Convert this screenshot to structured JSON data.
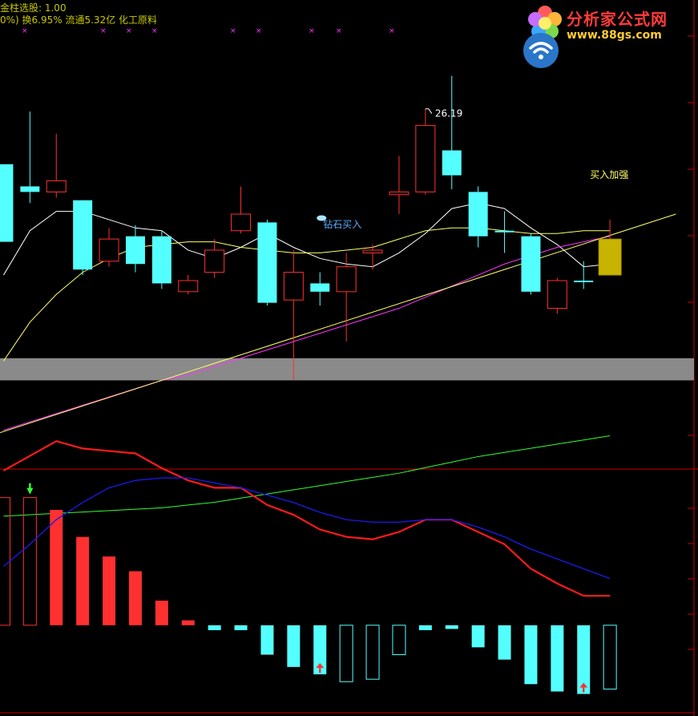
{
  "header": {
    "line1": "金柱选股: 1.00",
    "line2": "0%) 换6.95% 流通5.32亿 化工原料"
  },
  "watermark": {
    "site_name": "分析家公式网",
    "url": "www.88gs.com"
  },
  "colors": {
    "bull": "#ff3030",
    "bear": "#54ffff",
    "ma5": "#ffffff",
    "ma10": "#ffff66",
    "ma20": "#ff33ff",
    "ma60": "#33ff33",
    "trendline": "#ffff66",
    "band": "#8a8a8a",
    "gold": "#c8b400",
    "macd_fast": "#ff1a1a",
    "macd_slow": "#1a1aee",
    "axis": "#cc0000"
  },
  "chart_data": [
    {
      "type": "candlestick",
      "title": "",
      "annotations": [
        {
          "text": "26.19",
          "candle": 16,
          "kind": "high-label"
        },
        {
          "text": "钻石买入",
          "candle": 12,
          "kind": "signal"
        },
        {
          "text": "买入加强",
          "candle": 22,
          "kind": "signal"
        }
      ],
      "price_range": [
        12,
        28
      ],
      "candles": [
        {
          "o": 23.0,
          "c": 20.2,
          "h": 23.0,
          "l": 20.2
        },
        {
          "o": 22.2,
          "c": 22.0,
          "h": 24.9,
          "l": 21.6
        },
        {
          "o": 22.0,
          "c": 22.4,
          "h": 24.1,
          "l": 21.8
        },
        {
          "o": 21.7,
          "c": 19.2,
          "h": 21.7,
          "l": 19.0
        },
        {
          "o": 19.5,
          "c": 20.3,
          "h": 20.7,
          "l": 19.3
        },
        {
          "o": 20.4,
          "c": 19.4,
          "h": 20.8,
          "l": 19.1
        },
        {
          "o": 20.4,
          "c": 18.7,
          "h": 20.6,
          "l": 18.5
        },
        {
          "o": 18.4,
          "c": 18.8,
          "h": 19.0,
          "l": 18.3
        },
        {
          "o": 19.1,
          "c": 19.9,
          "h": 20.3,
          "l": 18.9
        },
        {
          "o": 20.6,
          "c": 21.2,
          "h": 22.2,
          "l": 20.5
        },
        {
          "o": 20.9,
          "c": 18.0,
          "h": 21.0,
          "l": 17.9
        },
        {
          "o": 18.1,
          "c": 19.1,
          "h": 19.9,
          "l": 15.2
        },
        {
          "o": 18.7,
          "c": 18.4,
          "h": 19.1,
          "l": 17.9
        },
        {
          "o": 18.4,
          "c": 19.3,
          "h": 19.8,
          "l": 16.6
        },
        {
          "o": 19.8,
          "c": 19.9,
          "h": 20.1,
          "l": 19.2
        },
        {
          "o": 21.9,
          "c": 22.0,
          "h": 23.3,
          "l": 21.2
        },
        {
          "o": 22.0,
          "c": 24.4,
          "h": 25.0,
          "l": 21.9
        },
        {
          "o": 23.5,
          "c": 22.6,
          "h": 26.19,
          "l": 22.1
        },
        {
          "o": 22.0,
          "c": 20.4,
          "h": 22.2,
          "l": 20.0
        },
        {
          "o": 20.6,
          "c": 20.55,
          "h": 21.3,
          "l": 19.8
        },
        {
          "o": 20.4,
          "c": 18.4,
          "h": 20.5,
          "l": 18.3
        },
        {
          "o": 17.8,
          "c": 18.8,
          "h": 18.9,
          "l": 17.6
        },
        {
          "o": 18.8,
          "c": 18.75,
          "h": 19.5,
          "l": 18.5
        },
        {
          "o": 19.0,
          "c": 20.3,
          "h": 21.0,
          "l": 19.0
        }
      ],
      "moving_averages": [
        {
          "key": "ma5",
          "values": [
            19.0,
            20.6,
            21.3,
            21.3,
            21.0,
            20.7,
            20.6,
            19.9,
            19.6,
            20.0,
            20.5,
            20.0,
            19.6,
            19.4,
            19.3,
            19.8,
            20.5,
            21.4,
            21.6,
            21.4,
            20.7,
            20.1,
            19.3,
            19.4
          ]
        },
        {
          "key": "ma10",
          "values": [
            15.9,
            17.3,
            18.3,
            19.1,
            19.6,
            20.0,
            20.1,
            20.2,
            20.2,
            20.0,
            19.9,
            19.8,
            19.8,
            19.9,
            20.0,
            20.3,
            20.6,
            20.7,
            20.7,
            20.6,
            20.5,
            20.5,
            20.6,
            20.6
          ]
        },
        {
          "key": "ma20",
          "values": [
            13.4,
            13.7,
            14.0,
            14.3,
            14.6,
            14.9,
            15.2,
            15.4,
            15.7,
            16.0,
            16.3,
            16.6,
            16.9,
            17.2,
            17.5,
            17.8,
            18.2,
            18.6,
            19.0,
            19.4,
            19.7,
            20.0,
            20.2,
            20.4
          ]
        },
        {
          "key": "ma60",
          "values": [
            10.3,
            10.35,
            10.4,
            10.45,
            10.5,
            10.55,
            10.6,
            10.7,
            10.8,
            10.95,
            11.1,
            11.25,
            11.4,
            11.55,
            11.7,
            11.85,
            12.05,
            12.25,
            12.45,
            12.6,
            12.75,
            12.9,
            13.05,
            13.2
          ]
        }
      ],
      "trendline": {
        "from": [
          0,
          13.2
        ],
        "to": [
          26,
          21.2
        ]
      },
      "gray_band": [
        15.2,
        16.0
      ]
    },
    {
      "type": "bar",
      "title": "",
      "value_range": [
        -3.6,
        6.2
      ],
      "histogram": [
        5.2,
        5.2,
        4.7,
        3.6,
        2.8,
        2.2,
        1.0,
        0.2,
        -0.2,
        -0.2,
        -1.2,
        -1.7,
        -2.0,
        -2.3,
        -2.2,
        -1.2,
        -0.2,
        -0.15,
        -0.9,
        -1.4,
        -2.4,
        -2.7,
        -2.8,
        -2.6
      ],
      "hollow_bars": [
        0,
        1,
        13,
        14,
        15,
        23
      ],
      "line_fast": [
        6.3,
        6.9,
        7.5,
        7.2,
        7.1,
        7.0,
        6.4,
        5.9,
        5.6,
        5.6,
        4.9,
        4.5,
        3.9,
        3.6,
        3.5,
        3.8,
        4.3,
        4.3,
        3.8,
        3.3,
        2.3,
        1.7,
        1.2,
        1.2
      ],
      "line_slow": [
        2.4,
        3.3,
        4.3,
        5.0,
        5.6,
        5.9,
        6.0,
        6.0,
        5.8,
        5.6,
        5.3,
        5.0,
        4.6,
        4.3,
        4.2,
        4.2,
        4.3,
        4.3,
        4.0,
        3.6,
        3.1,
        2.7,
        2.3,
        1.9
      ],
      "markers": [
        {
          "index": 1,
          "kind": "down-arrow",
          "color": "#33ff33"
        },
        {
          "index": 12,
          "kind": "up-arrow",
          "color": "#ff3333"
        },
        {
          "index": 22,
          "kind": "up-arrow",
          "color": "#ff3333"
        }
      ]
    }
  ]
}
